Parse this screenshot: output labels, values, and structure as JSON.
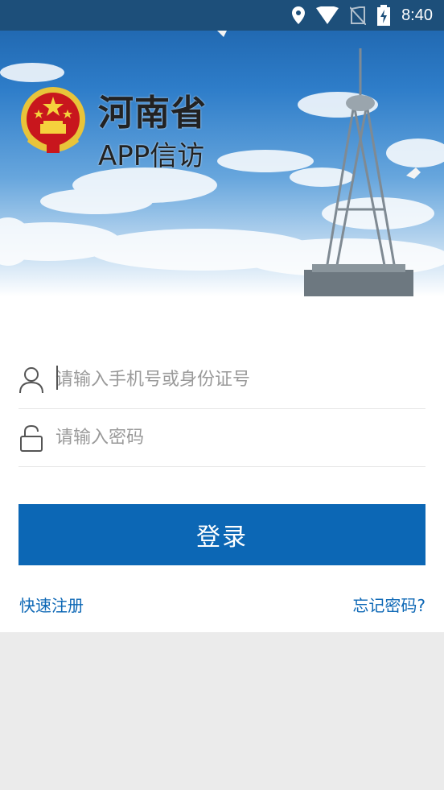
{
  "status_bar": {
    "time": "8:40",
    "icons": [
      "location-icon",
      "wifi-icon",
      "no-sim-icon",
      "battery-charging-icon"
    ]
  },
  "header": {
    "title": "河南省",
    "subtitle": "APP信访",
    "emblem": "national-emblem"
  },
  "login_form": {
    "phone_placeholder": "请输入手机号或身份证号",
    "phone_value": "",
    "password_placeholder": "请输入密码",
    "password_value": "",
    "login_label": "登录",
    "register_label": "快速注册",
    "forgot_label": "忘记密码?"
  },
  "colors": {
    "accent": "#0c67b5",
    "status_bar": "#1d4f7a",
    "background": "#ebebeb"
  }
}
